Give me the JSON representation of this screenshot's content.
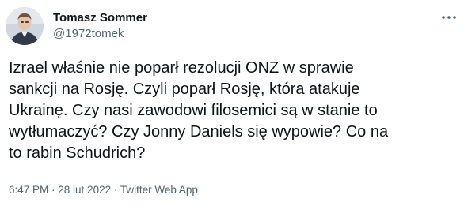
{
  "author": {
    "display_name": "Tomasz Sommer",
    "handle": "@1972tomek"
  },
  "icons": {
    "avatar": "profile-photo",
    "more": "more-options-ellipsis-icon"
  },
  "tweet": {
    "text": "Izrael właśnie nie poparł rezolucji ONZ w sprawie\nsankcji na Rosję. Czyli poparł Rosję, która atakuje\nUkrainę. Czy nasi zawodowi filosemici są w stanie to\nwytłumaczyć? Czy Jonny Daniels się wypowie? Co na\nto rabin Schudrich?"
  },
  "meta": {
    "time": "6:47 PM",
    "separator1": " · ",
    "date": "28 lut 2022",
    "separator2": " · ",
    "source": "Twitter Web App"
  },
  "colors": {
    "text": "#0f1419",
    "secondary": "#536471",
    "background": "#ffffff"
  }
}
